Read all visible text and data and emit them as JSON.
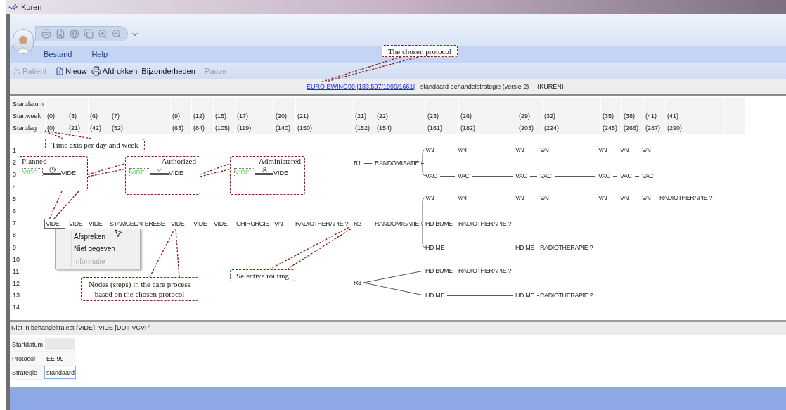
{
  "window": {
    "title": "Kuren"
  },
  "menu": [
    {
      "label": "Bestand"
    },
    {
      "label": "Help"
    }
  ],
  "commands": [
    {
      "label": "Patiënt",
      "kind": "patient",
      "disabled": true,
      "separator_before": false
    },
    {
      "label": "Nieuw",
      "kind": "new",
      "disabled": false,
      "separator_before": true
    },
    {
      "label": "Afdrukken",
      "kind": "print",
      "disabled": false,
      "separator_before": false
    },
    {
      "label": "Bijzonderheden",
      "kind": "text",
      "disabled": false,
      "separator_before": false
    },
    {
      "label": "Pauze",
      "kind": "text",
      "disabled": true,
      "separator_before": true
    }
  ],
  "protocol": {
    "link": "EURO EWING99 [183.597/1999/1661]",
    "strategy": "standaard behandelstrategie (versie 2)",
    "source": "(KUREN)"
  },
  "timeline": {
    "rows": [
      {
        "label": "Startdatum"
      },
      {
        "label": "Startweek",
        "values": [
          "(0)",
          "(3)",
          "(6)",
          "(7)",
          "(9)",
          "(12)",
          "(15)",
          "(17)",
          "(20)",
          "(21)",
          "(21)",
          "(22)",
          "(23)",
          "(26)",
          "(29)",
          "(32)",
          "(35)",
          "(38)",
          "(41)",
          "(41)"
        ]
      },
      {
        "label": "Startdag",
        "values": [
          "(0)",
          "(21)",
          "(42)",
          "(52)",
          "(63)",
          "(84)",
          "(105)",
          "(119)",
          "(140)",
          "(150)",
          "(152)",
          "(154)",
          "(161)",
          "(182)",
          "(203)",
          "(224)",
          "(245)",
          "(266)",
          "(287)",
          "(290)"
        ]
      }
    ]
  },
  "row_numbers": [
    "1",
    "2",
    "3",
    "4",
    "5",
    "6",
    "7",
    "8",
    "9",
    "10",
    "11",
    "12",
    "13",
    "14"
  ],
  "main_path": [
    {
      "text": "VIDE",
      "selected": true
    },
    {
      "text": "VIDE",
      "selected": false
    },
    {
      "text": "VIDE",
      "selected": false
    },
    {
      "text": "STAMCELAFERESE",
      "selected": false
    },
    {
      "text": "VIDE",
      "selected": false
    },
    {
      "text": "VIDE",
      "selected": false
    },
    {
      "text": "VIDE",
      "selected": false
    },
    {
      "text": "CHIRURGIE",
      "selected": false
    },
    {
      "text": "VAI",
      "selected": false
    },
    {
      "text": "RADIOTHERAPIE ?",
      "selected": false
    }
  ],
  "routes": [
    {
      "label": "R1",
      "step": "RANDOMISATIE",
      "arms": [
        [
          "VAI",
          "VAI",
          "VAI",
          "VAI",
          "VAI",
          "VAI",
          "VAI"
        ],
        [
          "VAC",
          "VAC",
          "VAC",
          "VAC",
          "VAC",
          "VAC",
          "VAC"
        ]
      ]
    },
    {
      "label": "R2",
      "step": "RANDOMISATIE",
      "arms": [
        [
          "VAI",
          "VAI",
          "VAI",
          "VAI",
          "VAI",
          "VAI",
          "VAI",
          "RADIOTHERAPIE ?"
        ],
        [
          "HD BUME",
          "RADIOTHERAPIE ?"
        ],
        [
          "HD ME",
          "HD ME",
          "RADIOTHERAPIE ?"
        ]
      ]
    },
    {
      "label": "R3",
      "arms": [
        [
          "HD BUME",
          "RADIOTHERAPIE ?"
        ],
        [
          "HD ME",
          "HD ME",
          "RADIOTHERAPIE ?"
        ]
      ]
    }
  ],
  "context_menu": [
    {
      "label": "Afspreken",
      "disabled": false
    },
    {
      "label": "Niet gegeven",
      "disabled": false
    },
    {
      "label": "Informatie",
      "disabled": true
    }
  ],
  "legend": [
    {
      "title": "Planned",
      "kind": "planned",
      "nodes": [
        "VIDE",
        "VIDE"
      ]
    },
    {
      "title": "Authorized",
      "kind": "authorized",
      "nodes": [
        "VIDE",
        "VIDE"
      ]
    },
    {
      "title": "Administered",
      "kind": "administered",
      "nodes": [
        "VIDE",
        "VIDE"
      ]
    }
  ],
  "callouts": [
    {
      "text": "The chosen protocol"
    },
    {
      "text": "Time axis per day and week"
    },
    {
      "text": "Nodes (steps) in the care process based on the chosen protocol"
    },
    {
      "text": "Selective routing"
    }
  ],
  "status_line": "Niet in behandeltraject (VIDE): VIDE [DOIFVCVP]",
  "details": [
    {
      "label": "Startdatum",
      "selected": false
    },
    {
      "label": "Protocol",
      "value": "EE 99",
      "selected": false
    },
    {
      "label": "Strategie",
      "value": "standaard",
      "selected": true
    }
  ]
}
